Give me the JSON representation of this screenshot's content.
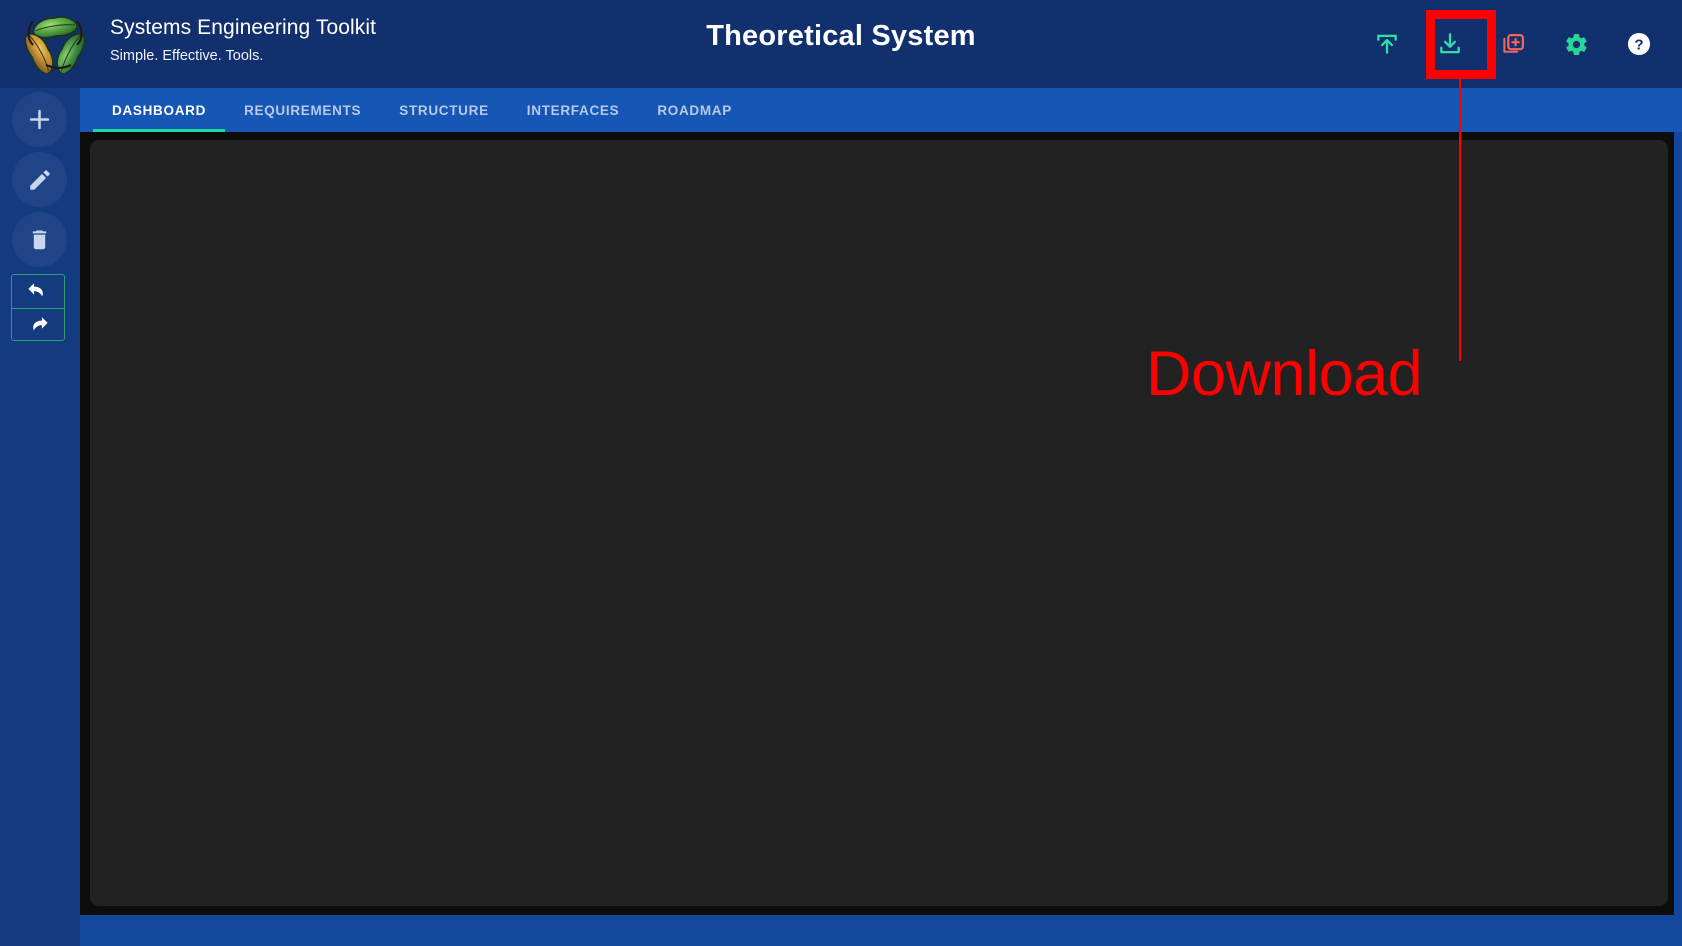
{
  "header": {
    "logo_icon": "three-leaves-recycle-logo",
    "app_title": "Systems Engineering Toolkit",
    "app_tagline": "Simple. Effective. Tools.",
    "project_title": "Theoretical System",
    "actions": [
      {
        "name": "upload-button",
        "icon": "upload-icon",
        "color": "#2ee0a8",
        "tooltip": "Upload"
      },
      {
        "name": "download-button",
        "icon": "download-icon",
        "color": "#2ee0a8",
        "tooltip": "Download"
      },
      {
        "name": "duplicate-button",
        "icon": "add-duplicate-icon",
        "color": "#f4665b",
        "tooltip": "New"
      },
      {
        "name": "settings-button",
        "icon": "gear-icon",
        "color": "#2bd694",
        "tooltip": "Settings"
      },
      {
        "name": "help-button",
        "icon": "question-circle-icon",
        "color": "#ffffff",
        "tooltip": "Help"
      }
    ]
  },
  "sidebar": {
    "items": [
      {
        "name": "add-button",
        "icon": "plus-icon",
        "label": "Add"
      },
      {
        "name": "edit-button",
        "icon": "pencil-icon",
        "label": "Edit"
      },
      {
        "name": "delete-button",
        "icon": "trash-icon",
        "label": "Delete"
      }
    ],
    "history": [
      {
        "name": "undo-button",
        "icon": "undo-arrow-icon",
        "label": "Undo"
      },
      {
        "name": "redo-button",
        "icon": "redo-arrow-icon",
        "label": "Redo"
      }
    ],
    "history_border_color": "#2e9e72"
  },
  "tabs": {
    "active_index": 0,
    "active_underline_color": "#23d99a",
    "items": [
      {
        "label": "DASHBOARD"
      },
      {
        "label": "REQUIREMENTS"
      },
      {
        "label": "STRUCTURE"
      },
      {
        "label": "INTERFACES"
      },
      {
        "label": "ROADMAP"
      }
    ]
  },
  "content": {
    "body_text": "",
    "background_color": "#222222"
  },
  "annotation": {
    "label": "Download",
    "color": "#ff0000",
    "target": "download-button"
  },
  "colors": {
    "header_bg": "#12306e",
    "rail_bg": "#143a80",
    "tabbar_bg": "#1657b5",
    "page_bg": "#12479b",
    "accent_green": "#23d99a",
    "accent_red": "#f4665b"
  }
}
